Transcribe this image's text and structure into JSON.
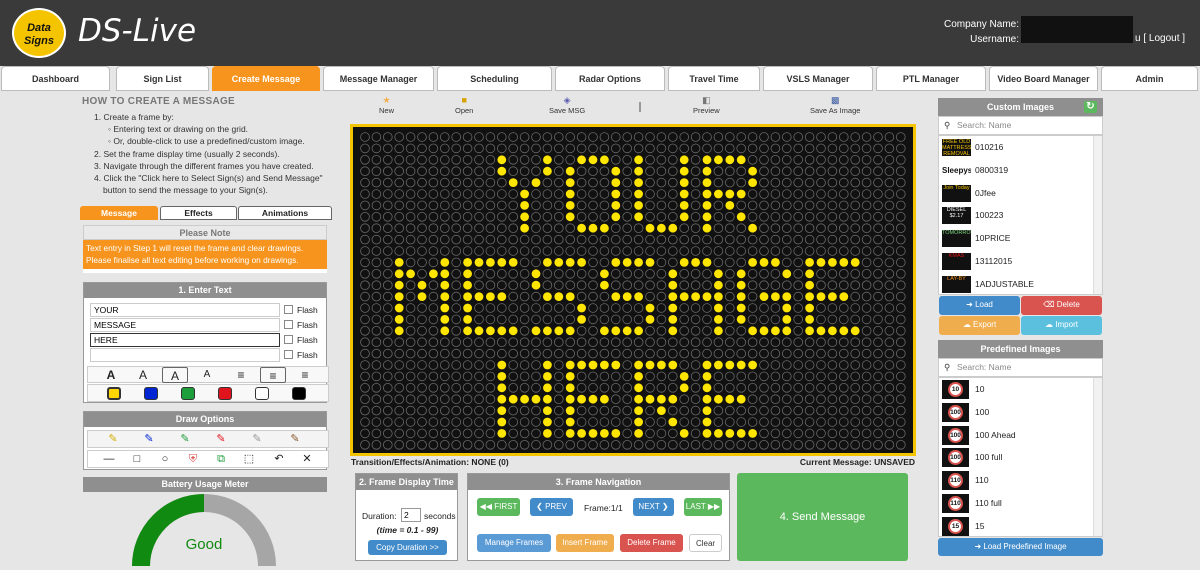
{
  "app": {
    "logo_line1": "Data",
    "logo_line2": "Signs",
    "title": "DS-Live"
  },
  "account": {
    "company_label": "Company Name:",
    "username_label": "Username:",
    "username_suffix": "u",
    "logout_label": "[ Logout ]"
  },
  "nav": {
    "tabs": [
      "Dashboard",
      "Sign List",
      "Create Message",
      "Message Manager",
      "Scheduling",
      "Radar Options",
      "Travel Time",
      "VSLS Manager",
      "PTL Manager",
      "Video Board Manager",
      "Admin"
    ],
    "active": "Create Message"
  },
  "howto": {
    "title": "HOW TO CREATE A MESSAGE",
    "steps": [
      "1. Create a frame by:",
      "Entering text or drawing on the grid.",
      "Or, double-click to use a predefined/custom image.",
      "2. Set the frame display time (usually 2 seconds).",
      "3. Navigate through the different frames you have created.",
      "4. Click the \"Click here to Select Sign(s) and Send Message\"",
      "button to send the message to your Sign(s)."
    ]
  },
  "left_tabs": [
    "Message",
    "Effects",
    "Animations"
  ],
  "note": {
    "title": "Please Note",
    "text": "Text entry in Step 1 will reset the frame and clear drawings. Please finalise all text editing before working on drawings."
  },
  "enter_text": {
    "title": "1. Enter Text",
    "lines": [
      "YOUR",
      "MESSAGE",
      "HERE",
      ""
    ],
    "flash_label": "Flash"
  },
  "format_glyphs": [
    "A",
    "A",
    "A",
    "A"
  ],
  "colors": [
    "#ffd600",
    "#0026d4",
    "#1c9e3a",
    "#e0141c",
    "#ffffff",
    "#000000"
  ],
  "draw_options": {
    "title": "Draw Options"
  },
  "battery": {
    "title": "Battery Usage Meter",
    "status": "Good",
    "level": 0.5
  },
  "toolbar": {
    "new": "New",
    "open": "Open",
    "save_msg": "Save MSG",
    "preview": "Preview",
    "save_image": "Save As Image"
  },
  "status": {
    "transition": "Transition/Effects/Animation: NONE (0)",
    "current": "Current Message: UNSAVED"
  },
  "display_time": {
    "title": "2. Frame Display Time",
    "duration_label": "Duration:",
    "duration_value": "2",
    "unit": "seconds",
    "range": "(time = 0.1 - 99)",
    "copy_label": "Copy Duration >>"
  },
  "frame_nav": {
    "title": "3. Frame Navigation",
    "first": "FIRST",
    "prev": "PREV",
    "frame_label": "Frame:1/1",
    "next": "NEXT",
    "last": "LAST",
    "manage": "Manage Frames",
    "insert": "Insert Frame",
    "delete": "Delete Frame",
    "clear": "Clear"
  },
  "send": {
    "label": "4. Send Message"
  },
  "custom_images": {
    "title": "Custom Images",
    "search_placeholder": "Search: Name",
    "items": [
      {
        "name": "010216",
        "thumb": "FREE OLD MATTRESS REMOVAL"
      },
      {
        "name": "0800319",
        "thumb": "Sleepys"
      },
      {
        "name": "0Jfee",
        "thumb": "Join Today"
      },
      {
        "name": "100223",
        "thumb": "DIESEL $2.17"
      },
      {
        "name": "10PRICE",
        "thumb": "TOMORROW"
      },
      {
        "name": "13112015",
        "thumb": "KMAS"
      },
      {
        "name": "1ADJUSTABLE",
        "thumb": "LAY-BY"
      }
    ],
    "load": "Load",
    "delete": "Delete",
    "export": "Export",
    "import": "Import"
  },
  "predefined_images": {
    "title": "Predefined Images",
    "search_placeholder": "Search: Name",
    "items": [
      {
        "name": "10",
        "sign": "10"
      },
      {
        "name": "100",
        "sign": "100"
      },
      {
        "name": "100 Ahead",
        "sign": "100"
      },
      {
        "name": "100 full",
        "sign": "100"
      },
      {
        "name": "110",
        "sign": "110"
      },
      {
        "name": "110 full",
        "sign": "110"
      },
      {
        "name": "15",
        "sign": "15"
      }
    ],
    "load_label": "Load Predefined Image"
  },
  "led_message": {
    "rows": [
      "YOUR",
      "MESSAGE",
      "HERE"
    ],
    "on_color": "#ffe600"
  }
}
